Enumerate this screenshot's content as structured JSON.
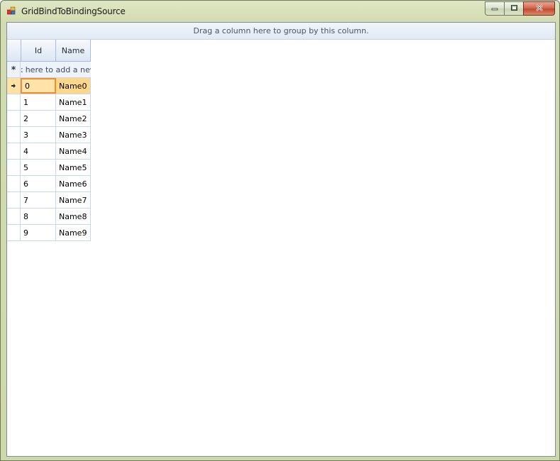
{
  "window": {
    "title": "GridBindToBindingSource"
  },
  "grid": {
    "group_panel_text": "Drag a column here to group by this column.",
    "columns": [
      "Id",
      "Name"
    ],
    "new_row_text": "Click here to add a new row",
    "rows": [
      {
        "id": "0",
        "name": "Name0"
      },
      {
        "id": "1",
        "name": "Name1"
      },
      {
        "id": "2",
        "name": "Name2"
      },
      {
        "id": "3",
        "name": "Name3"
      },
      {
        "id": "4",
        "name": "Name4"
      },
      {
        "id": "5",
        "name": "Name5"
      },
      {
        "id": "6",
        "name": "Name6"
      },
      {
        "id": "7",
        "name": "Name7"
      },
      {
        "id": "8",
        "name": "Name8"
      },
      {
        "id": "9",
        "name": "Name9"
      }
    ],
    "selected_row": 0
  },
  "icons": {
    "app": "app-icon",
    "minimize": "minimize-icon",
    "maximize": "maximize-icon",
    "close": "close-icon",
    "new_row": "asterisk-icon",
    "current_row": "row-indicator-arrow-icon"
  },
  "colors": {
    "title_bar": "#d3dcaf",
    "selected_row": "#ffdf9a",
    "focused_cell_border": "#f18d2a",
    "grid_line": "#c7d6e8"
  }
}
